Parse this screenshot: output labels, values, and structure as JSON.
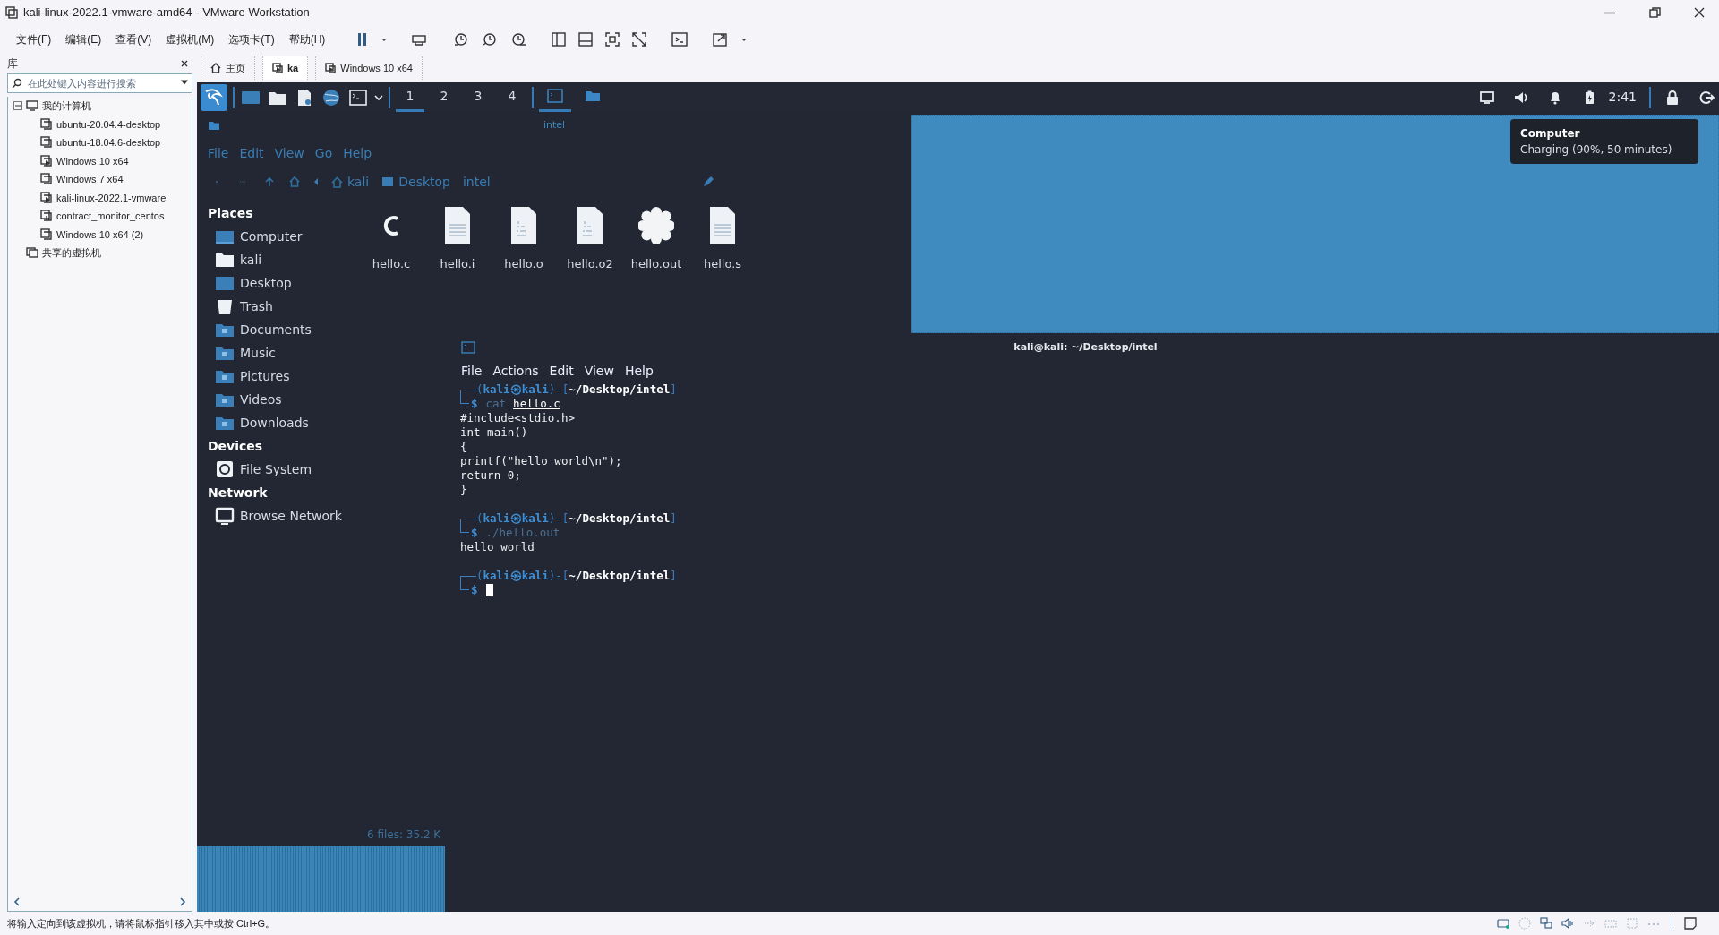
{
  "window": {
    "title": "kali-linux-2022.1-vmware-amd64 - VMware Workstation"
  },
  "menu": [
    "文件(F)",
    "编辑(E)",
    "查看(V)",
    "虚拟机(M)",
    "选项卡(T)",
    "帮助(H)"
  ],
  "library": {
    "title": "库",
    "search": {
      "placeholder": "在此处键入内容进行搜索"
    },
    "tree": [
      {
        "label": "我的计算机",
        "kind": "computer",
        "expanded": true,
        "children": [
          {
            "label": "ubuntu-20.04.4-desktop",
            "kind": "vm"
          },
          {
            "label": "ubuntu-18.04.6-desktop",
            "kind": "vm"
          },
          {
            "label": "Windows 10 x64",
            "kind": "vm-running"
          },
          {
            "label": "Windows 7 x64",
            "kind": "vm"
          },
          {
            "label": "kali-linux-2022.1-vmware",
            "kind": "vm-running"
          },
          {
            "label": "contract_monitor_centos",
            "kind": "vm-stats"
          },
          {
            "label": "Windows 10 x64 (2)",
            "kind": "vm"
          }
        ]
      },
      {
        "label": "共享的虚拟机",
        "kind": "shared"
      }
    ]
  },
  "tabs": [
    {
      "label": "主页",
      "kind": "home",
      "selected": false
    },
    {
      "label": "ka",
      "kind": "vm",
      "selected": true
    },
    {
      "label": "Windows 10 x64",
      "kind": "vm",
      "selected": false
    }
  ],
  "kali_panel": {
    "workspaces": [
      {
        "label": "1",
        "selected": true
      },
      {
        "label": "2",
        "selected": false
      },
      {
        "label": "3",
        "selected": false
      },
      {
        "label": "4",
        "selected": false
      }
    ],
    "tasks": [
      {
        "kind": "terminal",
        "selected": true
      },
      {
        "kind": "folder",
        "selected": false
      }
    ],
    "clock": "2:41"
  },
  "file_manager": {
    "title": "intel",
    "menu": [
      "File",
      "Edit",
      "View",
      "Go",
      "Help"
    ],
    "path": [
      "kali",
      "Desktop",
      "intel"
    ],
    "sections": [
      {
        "heading": "Places",
        "items": [
          {
            "label": "Computer",
            "kind": "computer"
          },
          {
            "label": "kali",
            "kind": "home"
          },
          {
            "label": "Desktop",
            "kind": "desktop"
          },
          {
            "label": "Trash",
            "kind": "trash"
          },
          {
            "label": "Documents",
            "kind": "folder"
          },
          {
            "label": "Music",
            "kind": "folder"
          },
          {
            "label": "Pictures",
            "kind": "folder"
          },
          {
            "label": "Videos",
            "kind": "folder"
          },
          {
            "label": "Downloads",
            "kind": "folder"
          }
        ]
      },
      {
        "heading": "Devices",
        "items": [
          {
            "label": "File System",
            "kind": "drive"
          }
        ]
      },
      {
        "heading": "Network",
        "items": [
          {
            "label": "Browse Network",
            "kind": "network"
          }
        ]
      }
    ],
    "files": [
      {
        "name": "hello.c",
        "kind": "c-source"
      },
      {
        "name": "hello.i",
        "kind": "text"
      },
      {
        "name": "hello.o",
        "kind": "binary"
      },
      {
        "name": "hello.o2",
        "kind": "binary"
      },
      {
        "name": "hello.out",
        "kind": "executable"
      },
      {
        "name": "hello.s",
        "kind": "text"
      }
    ],
    "status": "6 files: 35.2 K"
  },
  "tooltip": {
    "title": "Computer",
    "text": "Charging (90%, 50 minutes)"
  },
  "terminal": {
    "title": "kali@kali: ~/Desktop/intel",
    "menu": [
      "File",
      "Actions",
      "Edit",
      "View",
      "Help"
    ],
    "lines": [
      {
        "kind": "prompt",
        "text": "(**kali㉿kali**)-[**~/Desktop/intel**]",
        "symbol": "$",
        "command": "cat",
        "argument": "hello.c"
      },
      {
        "kind": "output",
        "text": "#include<stdio.h>"
      },
      {
        "kind": "output",
        "text": "int main()"
      },
      {
        "kind": "output",
        "text": "{"
      },
      {
        "kind": "output",
        "text": "printf(\"hello world\\n\");"
      },
      {
        "kind": "output",
        "text": "return 0;"
      },
      {
        "kind": "output",
        "text": "}"
      },
      {
        "kind": "blank"
      },
      {
        "kind": "prompt",
        "text": "(**kali㉿kali**)-[**~/Desktop/intel**]",
        "symbol": "$",
        "command": "./hello.out"
      },
      {
        "kind": "output",
        "text": "hello world"
      },
      {
        "kind": "blank"
      },
      {
        "kind": "prompt",
        "text": "(**kali㉿kali**)-[**~/Desktop/intel**]",
        "symbol": "$",
        "cursor": true
      }
    ]
  },
  "status_bar": {
    "text": "将输入定向到该虚拟机，请将鼠标指针移入其中或按 Ctrl+G。"
  }
}
